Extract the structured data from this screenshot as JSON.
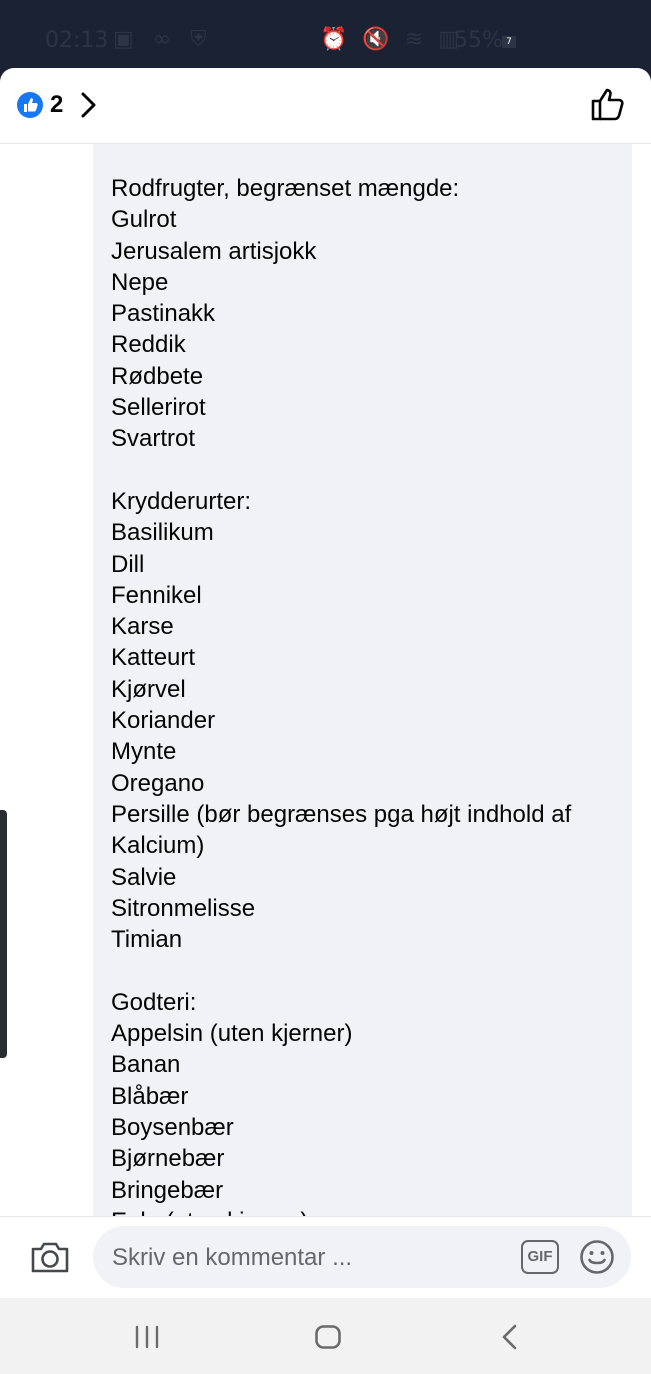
{
  "status_bar": {
    "time": "02:13",
    "left_icons": "▣ ∞ ⛨",
    "right_icons": "⏰ 🔇 ≋ ▥",
    "battery": "55%",
    "notification_count": "7"
  },
  "header": {
    "like_count": "2"
  },
  "comment": {
    "text": "Rodfrugter, begrænset mængde:\nGulrot\nJerusalem artisjokk\nNepe\nPastinakk\nReddik\nRødbete\nSellerirot\nSvartrot\n\nKrydderurter:\nBasilikum\nDill\nFennikel\nKarse\nKatteurt\nKjørvel\nKoriander\nMynte\nOregano\nPersille (bør begrænses pga højt indhold af Kalcium)\nSalvie\nSitronmelisse\nTimian\n\nGodteri:\nAppelsin (uten kjerner)\nBanan\nBlåbær\nBoysenbær\nBjørnebær\nBringebær\nEple (uten kjerner)"
  },
  "composer": {
    "placeholder": "Skriv en kommentar ...",
    "gif_label": "GIF"
  },
  "icons": {
    "like_badge": "thumbs-up-icon",
    "chevron": "chevron-right-icon",
    "like_button": "thumbs-up-outline-icon",
    "camera": "camera-icon",
    "emoji": "smiley-icon",
    "nav_recents": "recents-icon",
    "nav_home": "home-icon",
    "nav_back": "back-icon"
  },
  "colors": {
    "accent": "#1877f2",
    "status_bar_bg": "#1a2234",
    "bubble_bg": "#f0f2f5",
    "placeholder_text": "#65676b"
  }
}
